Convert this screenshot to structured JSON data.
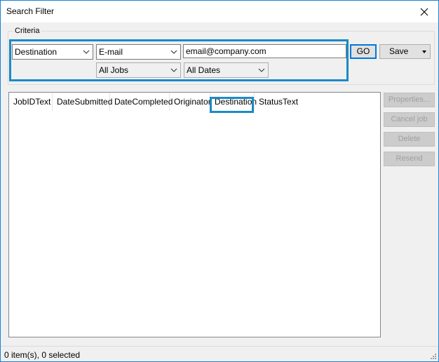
{
  "window": {
    "title": "Search Filter"
  },
  "criteria": {
    "label": "Criteria",
    "field": "Destination",
    "transport": "E-mail",
    "search_value": "email@company.com",
    "job_filter": "All Jobs",
    "date_filter": "All Dates"
  },
  "buttons": {
    "go": "GO",
    "save": "Save",
    "properties": "Properties...",
    "cancel_job": "Cancel job",
    "delete": "Delete",
    "resend": "Resend"
  },
  "list": {
    "columns": [
      "JobIDText",
      "DateSubmitted",
      "DateCompleted",
      "Originator",
      "Destination",
      "StatusText"
    ]
  },
  "status": {
    "text": "0 item(s), 0 selected"
  },
  "colors": {
    "highlight": "#1b8ac7",
    "default_button_border": "#0078d7"
  },
  "icons": {
    "close": "close-icon",
    "dropdown": "chevron-down-icon",
    "grip": "resize-grip-icon"
  }
}
